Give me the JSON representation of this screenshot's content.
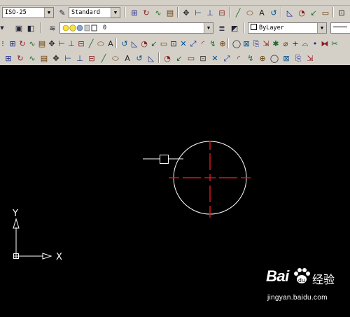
{
  "toolbar_styles": {
    "dimstyle_value": "ISO-25",
    "textstyle_value": "Standard"
  },
  "toolbar_layers": {
    "layer_value": "0",
    "linetype_value": "ByLayer"
  },
  "icons": {
    "row1": [
      "dim-linear-icon",
      "dim-aligned-icon",
      "dim-arc-icon",
      "dim-ordinate-icon",
      "dim-radius-icon",
      "dim-jogged-icon",
      "dim-diameter-icon",
      "dim-angular-icon",
      "dim-quick-icon",
      "dim-baseline-icon",
      "dim-continue-icon",
      "qleader-icon",
      "tolerance-icon",
      "center-mark-icon",
      "dim-edit-icon",
      "dim-text-edit-icon",
      "dim-update-icon"
    ],
    "row2_left": [
      "layer-manager-icon",
      "layer-prev-icon"
    ],
    "row3": [
      "line-icon",
      "construction-line-icon",
      "polyline-icon",
      "polygon-icon",
      "rectangle-icon",
      "arc-icon",
      "circle-icon",
      "revcloud-icon",
      "spline-icon",
      "ellipse-icon",
      "insert-block-icon",
      "make-block-icon",
      "point-icon",
      "hatch-icon",
      "region-icon",
      "table-icon",
      "mtext-icon",
      "erase-icon",
      "copy-icon",
      "mirror-icon",
      "offset-icon",
      "array-icon",
      "move-icon",
      "rotate-icon",
      "scale-icon",
      "stretch-icon",
      "trim-icon",
      "extend-icon",
      "break-icon",
      "join-icon",
      "chamfer-icon",
      "fillet-icon",
      "explode-icon"
    ],
    "row4": [
      "snap-endpoint-icon",
      "snap-midpoint-icon",
      "snap-intersection-icon",
      "snap-apparent-icon",
      "snap-extension-icon",
      "snap-center-icon",
      "snap-quadrant-icon",
      "snap-tangent-icon",
      "snap-perpendicular-icon",
      "snap-parallel-icon",
      "snap-insert-icon",
      "snap-node-icon",
      "snap-nearest-icon",
      "snap-none-icon",
      "osnap-settings-icon",
      "dim-style-icon",
      "block-editor-icon",
      "attribute-icon",
      "layout-icon",
      "plot-icon",
      "style-manager-icon",
      "properties-icon",
      "design-center-icon",
      "tool-palette-icon",
      "markup-icon",
      "quickcalc-icon"
    ]
  },
  "ucs": {
    "x_label": "X",
    "y_label": "Y"
  },
  "watermark": {
    "logo_text": "Bai",
    "logo_text2": "经验",
    "url": "jingyan.baidu.com"
  }
}
